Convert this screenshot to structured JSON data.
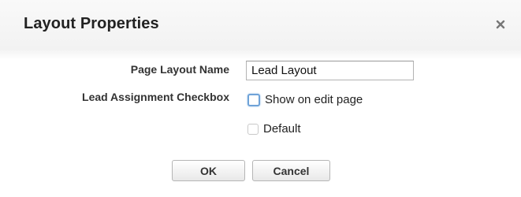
{
  "dialog": {
    "title": "Layout Properties",
    "close_icon": "close-icon"
  },
  "form": {
    "layout_name_label": "Page Layout Name",
    "layout_name_value": "Lead Layout",
    "assignment_label": "Lead Assignment Checkbox",
    "show_on_edit_label": "Show on edit page",
    "show_on_edit_checked": false,
    "default_label": "Default",
    "default_checked": false
  },
  "buttons": {
    "ok_label": "OK",
    "cancel_label": "Cancel"
  },
  "colors": {
    "focus_outline": "#6fa3d8",
    "header_bg": "#f2f2f2"
  }
}
